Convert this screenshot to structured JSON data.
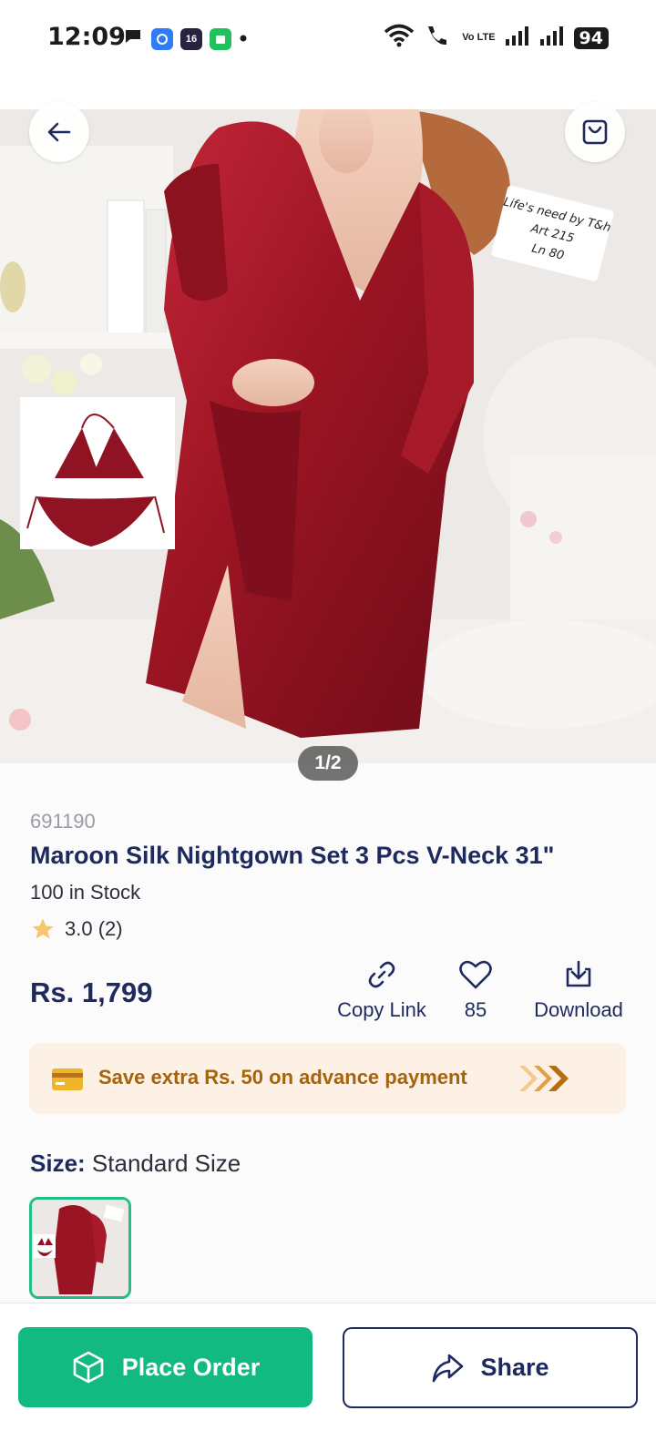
{
  "status_bar": {
    "time": "12:09",
    "notification_badge": "16",
    "network_label": "Vo LTE",
    "battery": "94"
  },
  "hero": {
    "pager": "1/2",
    "image_tag": [
      "Life's need by T&h",
      "Art 215",
      "Ln 80"
    ]
  },
  "product": {
    "sku": "691190",
    "title": "Maroon Silk Nightgown Set 3 Pcs V-Neck 31\"",
    "stock": "100 in Stock",
    "rating": "3.0 (2)",
    "price": "Rs. 1,799"
  },
  "actions": {
    "copy_link": "Copy Link",
    "likes": "85",
    "download": "Download"
  },
  "promo": {
    "text": "Save extra Rs. 50 on advance payment"
  },
  "size": {
    "label": "Size:",
    "value": "Standard Size"
  },
  "bottom": {
    "place_order": "Place Order",
    "share": "Share"
  },
  "colors": {
    "primary_navy": "#1e2a5e",
    "accent_green": "#12b981",
    "promo_bg": "#fdf0e4",
    "promo_text": "#a5640c",
    "maroon": "#9b1423"
  }
}
